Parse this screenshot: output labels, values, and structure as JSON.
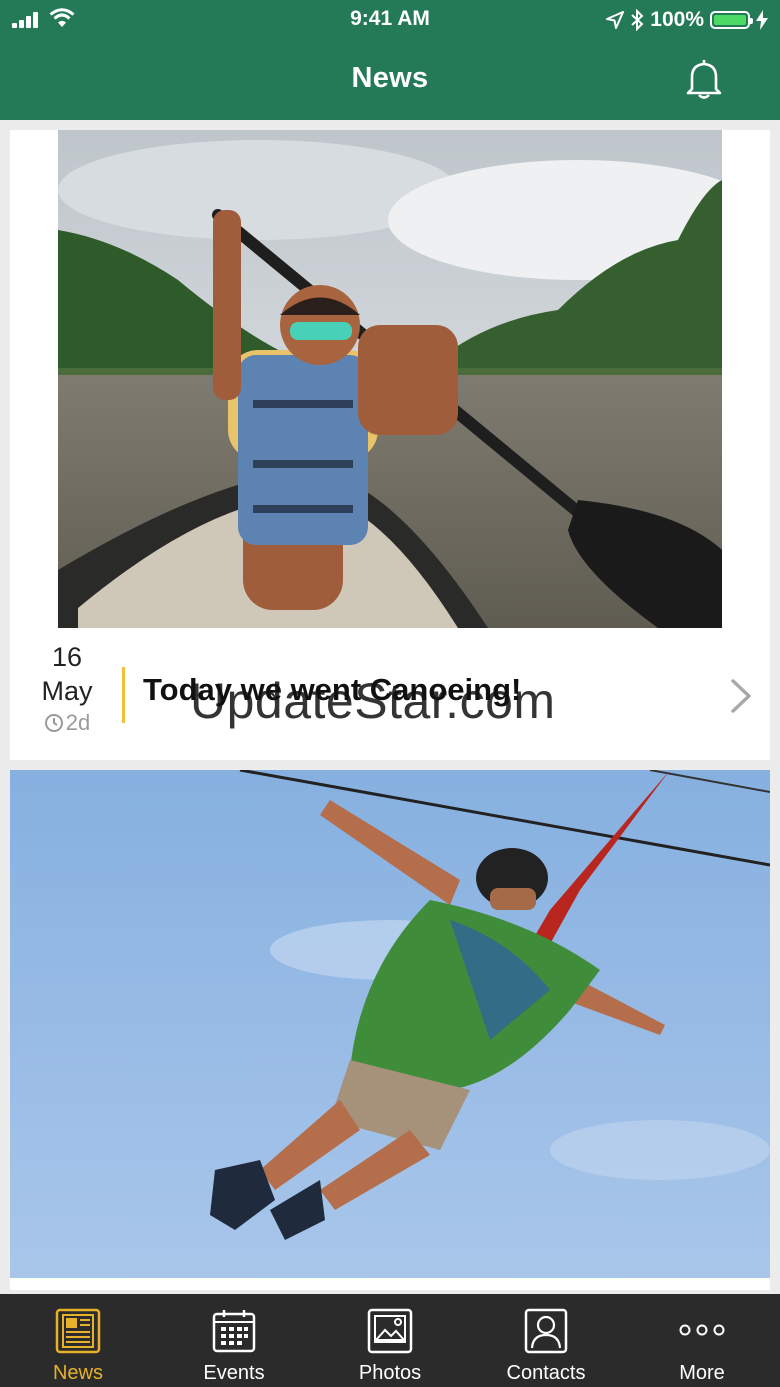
{
  "status_bar": {
    "time": "9:41 AM",
    "battery": "100%"
  },
  "header": {
    "title": "News"
  },
  "news_items": [
    {
      "date_day": "16",
      "date_month": "May",
      "age": "2d",
      "title": "Today we went Canoeing!"
    }
  ],
  "watermark": "UpdateStar.com",
  "tabbar": {
    "tabs": [
      {
        "label": "News",
        "icon": "newspaper-icon",
        "active": true
      },
      {
        "label": "Events",
        "icon": "calendar-icon",
        "active": false
      },
      {
        "label": "Photos",
        "icon": "photo-icon",
        "active": false
      },
      {
        "label": "Contacts",
        "icon": "contact-icon",
        "active": false
      },
      {
        "label": "More",
        "icon": "more-icon",
        "active": false
      }
    ]
  },
  "colors": {
    "header": "#247a56",
    "accent": "#e8b12b",
    "tabbar": "#2b2b2b"
  }
}
